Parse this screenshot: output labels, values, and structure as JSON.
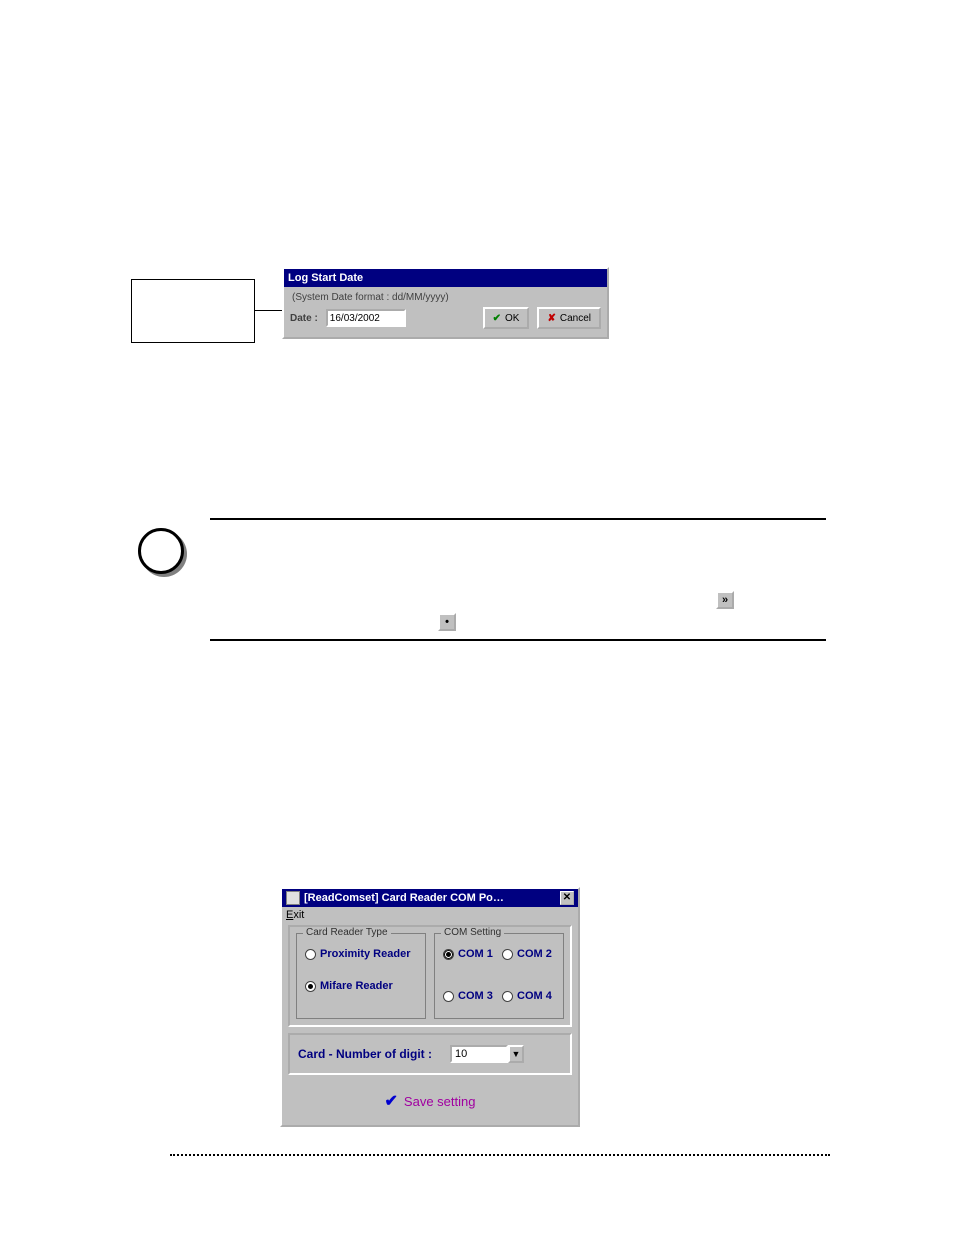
{
  "dialog1": {
    "title": "Log Start Date",
    "groupLabel": "(System Date format : dd/MM/yyyy)",
    "dateLabel": "Date :",
    "dateValue": "16/03/2002",
    "okLabel": "OK",
    "cancelLabel": "Cancel"
  },
  "inlineButtons": {
    "chevron": "»",
    "dot": "•"
  },
  "dialog2": {
    "title": "[ReadComset]     Card Reader COM Po…",
    "menuExit": "Exit",
    "cardReaderTypeLegend": "Card Reader Type",
    "comSettingLegend": "COM Setting",
    "proximityLabel": "Proximity Reader",
    "mifareLabel": "Mifare Reader",
    "com1": "COM 1",
    "com2": "COM 2",
    "com3": "COM 3",
    "com4": "COM 4",
    "digitLabel": "Card - Number of digit :",
    "digitValue": "10",
    "saveLabel": "Save setting"
  }
}
